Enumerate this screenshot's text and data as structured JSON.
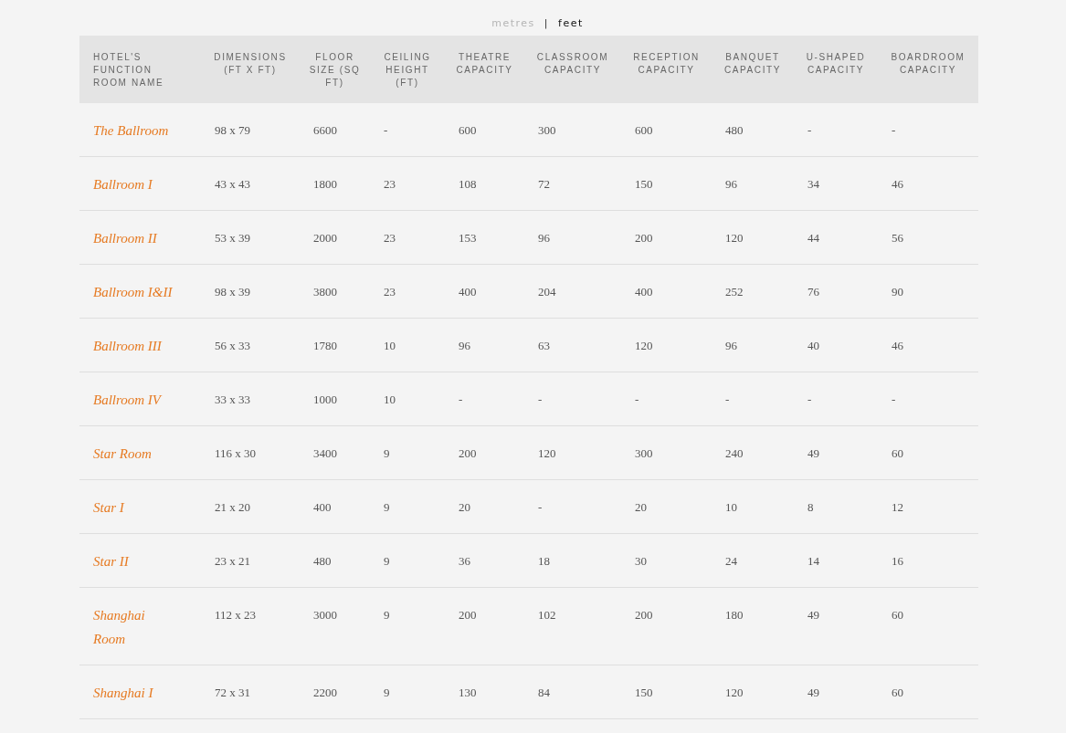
{
  "unit_toggle": [
    {
      "label": "metres",
      "selected": false
    },
    {
      "label": "feet",
      "selected": true
    }
  ],
  "unit_separator": "|",
  "table": {
    "columns": [
      "HOTEL'S FUNCTION ROOM NAME",
      "DIMENSIONS (FT X FT)",
      "FLOOR SIZE (SQ FT)",
      "CEILING HEIGHT (FT)",
      "THEATRE CAPACITY",
      "CLASSROOM CAPACITY",
      "RECEPTION CAPACITY",
      "BANQUET CAPACITY",
      "U-SHAPED CAPACITY",
      "BOARDROOM CAPACITY"
    ],
    "rows": [
      [
        "The Ballroom",
        "98 x 79",
        "6600",
        "-",
        "600",
        "300",
        "600",
        "480",
        "-",
        "-"
      ],
      [
        "Ballroom I",
        "43 x 43",
        "1800",
        "23",
        "108",
        "72",
        "150",
        "96",
        "34",
        "46"
      ],
      [
        "Ballroom II",
        "53 x 39",
        "2000",
        "23",
        "153",
        "96",
        "200",
        "120",
        "44",
        "56"
      ],
      [
        "Ballroom I&II",
        "98 x 39",
        "3800",
        "23",
        "400",
        "204",
        "400",
        "252",
        "76",
        "90"
      ],
      [
        "Ballroom III",
        "56 x 33",
        "1780",
        "10",
        "96",
        "63",
        "120",
        "96",
        "40",
        "46"
      ],
      [
        "Ballroom IV",
        "33 x 33",
        "1000",
        "10",
        "-",
        "-",
        "-",
        "-",
        "-",
        "-"
      ],
      [
        "Star Room",
        "116 x 30",
        "3400",
        "9",
        "200",
        "120",
        "300",
        "240",
        "49",
        "60"
      ],
      [
        "Star I",
        "21 x 20",
        "400",
        "9",
        "20",
        "-",
        "20",
        "10",
        "8",
        "12"
      ],
      [
        "Star II",
        "23 x 21",
        "480",
        "9",
        "36",
        "18",
        "30",
        "24",
        "14",
        "16"
      ],
      [
        "Shanghai Room",
        "112 x 23",
        "3000",
        "9",
        "200",
        "102",
        "200",
        "180",
        "49",
        "60"
      ],
      [
        "Shanghai I",
        "72 x 31",
        "2200",
        "9",
        "130",
        "84",
        "150",
        "120",
        "49",
        "60"
      ]
    ]
  }
}
